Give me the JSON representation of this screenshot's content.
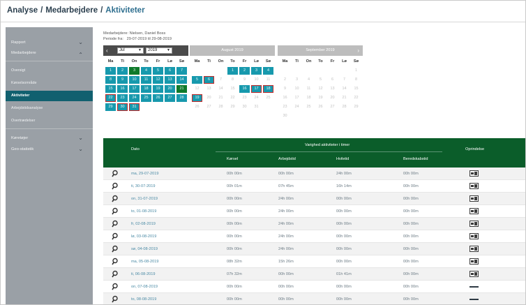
{
  "breadcrumb": {
    "part1": "Analyse",
    "part2": "Medarbejdere",
    "part3": "Aktiviteter",
    "separator": "/"
  },
  "sidebar": {
    "rapport": "Rapport",
    "medarbejdere": "Medarbejdere",
    "sub": [
      "Oversigt",
      "Kørselsområde",
      "Aktiviteter",
      "Arbejdstidsanalyse",
      "Overtrædelser"
    ],
    "active_index": 2,
    "koretojer": "Køretøjer",
    "geo": "Geo-statistik",
    "chevron_up": "⌃",
    "chevron_down": "⌄"
  },
  "info": {
    "employee_label": "Medarbejdere:",
    "employee_value": "Nielsen, Daniel Boss",
    "period_label": "Periode fra:",
    "period_value": "29-07-2019 til 29-08-2019"
  },
  "calendar": {
    "weekdays": [
      "Ma",
      "Ti",
      "On",
      "To",
      "Fr",
      "Lø",
      "Sø"
    ],
    "month_select": "Jul",
    "year_select": "2019",
    "prev": "‹",
    "next": "›",
    "months": [
      {
        "title": "",
        "header_style": "dark",
        "weeks": [
          [
            {
              "d": "1",
              "c": "teal"
            },
            {
              "d": "2",
              "c": "teal"
            },
            {
              "d": "3",
              "c": "green"
            },
            {
              "d": "4",
              "c": "teal"
            },
            {
              "d": "5",
              "c": "teal"
            },
            {
              "d": "6",
              "c": "teal"
            },
            {
              "d": "7",
              "c": "teal"
            }
          ],
          [
            {
              "d": "8",
              "c": "teal"
            },
            {
              "d": "9",
              "c": "teal"
            },
            {
              "d": "10",
              "c": "teal"
            },
            {
              "d": "11",
              "c": "teal"
            },
            {
              "d": "12",
              "c": "teal"
            },
            {
              "d": "13",
              "c": "teal"
            },
            {
              "d": "14",
              "c": "teal"
            }
          ],
          [
            {
              "d": "15",
              "c": "teal"
            },
            {
              "d": "16",
              "c": "teal"
            },
            {
              "d": "17",
              "c": "teal"
            },
            {
              "d": "18",
              "c": "teal"
            },
            {
              "d": "19",
              "c": "teal"
            },
            {
              "d": "20",
              "c": "teal"
            },
            {
              "d": "21",
              "c": "green"
            }
          ],
          [
            {
              "d": "22",
              "c": "teal red"
            },
            {
              "d": "23",
              "c": "teal"
            },
            {
              "d": "24",
              "c": "teal"
            },
            {
              "d": "25",
              "c": "teal"
            },
            {
              "d": "26",
              "c": "teal"
            },
            {
              "d": "27",
              "c": "teal"
            },
            {
              "d": "28",
              "c": "teal"
            }
          ],
          [
            {
              "d": "29",
              "c": "teal"
            },
            {
              "d": "30",
              "c": "teal red"
            },
            {
              "d": "31",
              "c": "teal red"
            },
            {
              "d": "",
              "c": ""
            },
            {
              "d": "",
              "c": ""
            },
            {
              "d": "",
              "c": ""
            },
            {
              "d": "",
              "c": ""
            }
          ]
        ]
      },
      {
        "title": "August 2019",
        "header_style": "light",
        "weeks": [
          [
            {
              "d": "",
              "c": ""
            },
            {
              "d": "",
              "c": ""
            },
            {
              "d": "",
              "c": ""
            },
            {
              "d": "1",
              "c": "teal"
            },
            {
              "d": "2",
              "c": "teal"
            },
            {
              "d": "3",
              "c": "teal"
            },
            {
              "d": "4",
              "c": "teal"
            }
          ],
          [
            {
              "d": "5",
              "c": "teal"
            },
            {
              "d": "6",
              "c": "teal red"
            },
            {
              "d": "7",
              "c": "mute"
            },
            {
              "d": "8",
              "c": "mute"
            },
            {
              "d": "9",
              "c": "mute"
            },
            {
              "d": "10",
              "c": "mute"
            },
            {
              "d": "11",
              "c": "mute"
            }
          ],
          [
            {
              "d": "12",
              "c": "mute"
            },
            {
              "d": "13",
              "c": "mute"
            },
            {
              "d": "14",
              "c": "mute"
            },
            {
              "d": "15",
              "c": "mute"
            },
            {
              "d": "16",
              "c": "teal"
            },
            {
              "d": "17",
              "c": "teal red"
            },
            {
              "d": "18",
              "c": "teal red"
            }
          ],
          [
            {
              "d": "19",
              "c": "teal red"
            },
            {
              "d": "20",
              "c": "mute"
            },
            {
              "d": "21",
              "c": "mute"
            },
            {
              "d": "22",
              "c": "mute"
            },
            {
              "d": "23",
              "c": "mute"
            },
            {
              "d": "24",
              "c": "mute"
            },
            {
              "d": "25",
              "c": "mute"
            }
          ],
          [
            {
              "d": "26",
              "c": "mute"
            },
            {
              "d": "27",
              "c": "mute"
            },
            {
              "d": "28",
              "c": "mute"
            },
            {
              "d": "29",
              "c": "mute"
            },
            {
              "d": "30",
              "c": "mute"
            },
            {
              "d": "31",
              "c": "mute"
            },
            {
              "d": "",
              "c": ""
            }
          ]
        ]
      },
      {
        "title": "September 2019",
        "header_style": "light",
        "weeks": [
          [
            {
              "d": "",
              "c": ""
            },
            {
              "d": "",
              "c": ""
            },
            {
              "d": "",
              "c": ""
            },
            {
              "d": "",
              "c": ""
            },
            {
              "d": "",
              "c": ""
            },
            {
              "d": "",
              "c": ""
            },
            {
              "d": "1",
              "c": "mute"
            }
          ],
          [
            {
              "d": "2",
              "c": "mute"
            },
            {
              "d": "3",
              "c": "mute"
            },
            {
              "d": "4",
              "c": "mute"
            },
            {
              "d": "5",
              "c": "mute"
            },
            {
              "d": "6",
              "c": "mute"
            },
            {
              "d": "7",
              "c": "mute"
            },
            {
              "d": "8",
              "c": "mute"
            }
          ],
          [
            {
              "d": "9",
              "c": "mute"
            },
            {
              "d": "10",
              "c": "mute"
            },
            {
              "d": "11",
              "c": "mute"
            },
            {
              "d": "12",
              "c": "mute"
            },
            {
              "d": "13",
              "c": "mute"
            },
            {
              "d": "14",
              "c": "mute"
            },
            {
              "d": "15",
              "c": "mute"
            }
          ],
          [
            {
              "d": "16",
              "c": "mute"
            },
            {
              "d": "17",
              "c": "mute"
            },
            {
              "d": "18",
              "c": "mute"
            },
            {
              "d": "19",
              "c": "mute"
            },
            {
              "d": "20",
              "c": "mute"
            },
            {
              "d": "21",
              "c": "mute"
            },
            {
              "d": "22",
              "c": "mute"
            }
          ],
          [
            {
              "d": "23",
              "c": "mute"
            },
            {
              "d": "24",
              "c": "mute"
            },
            {
              "d": "25",
              "c": "mute"
            },
            {
              "d": "26",
              "c": "mute"
            },
            {
              "d": "27",
              "c": "mute"
            },
            {
              "d": "28",
              "c": "mute"
            },
            {
              "d": "29",
              "c": "mute"
            }
          ],
          [
            {
              "d": "30",
              "c": "mute"
            },
            {
              "d": "",
              "c": ""
            },
            {
              "d": "",
              "c": ""
            },
            {
              "d": "",
              "c": ""
            },
            {
              "d": "",
              "c": ""
            },
            {
              "d": "",
              "c": ""
            },
            {
              "d": "",
              "c": ""
            }
          ]
        ]
      }
    ]
  },
  "table": {
    "col_dato": "Dato",
    "group_title": "Varighed aktiviteter i timer",
    "col_korsel": "Kørsel",
    "col_arbejd": "Arbejdstid",
    "col_hvile": "Hviletid",
    "col_beredskab": "Beredskabstid",
    "col_oprindelse": "Oprindelse",
    "rows": [
      {
        "date": "ma, 29-07-2019",
        "korsel": "00h 00m",
        "arbejd": "00h 00m",
        "hvile": "24h 00m",
        "beredskab": "00h 00m",
        "orig": "icon"
      },
      {
        "date": "ti, 30-07-2019",
        "korsel": "00h 01m",
        "arbejd": "07h 45m",
        "hvile": "16h 14m",
        "beredskab": "00h 00m",
        "orig": "icon"
      },
      {
        "date": "on, 31-07-2019",
        "korsel": "00h 00m",
        "arbejd": "24h 00m",
        "hvile": "00h 00m",
        "beredskab": "00h 00m",
        "orig": "icon"
      },
      {
        "date": "to, 01-08-2019",
        "korsel": "00h 00m",
        "arbejd": "24h 00m",
        "hvile": "00h 00m",
        "beredskab": "00h 00m",
        "orig": "icon"
      },
      {
        "date": "fr, 02-08-2019",
        "korsel": "00h 00m",
        "arbejd": "24h 00m",
        "hvile": "00h 00m",
        "beredskab": "00h 00m",
        "orig": "icon"
      },
      {
        "date": "lø, 03-08-2019",
        "korsel": "00h 00m",
        "arbejd": "24h 00m",
        "hvile": "00h 00m",
        "beredskab": "00h 00m",
        "orig": "icon"
      },
      {
        "date": "sø, 04-08-2019",
        "korsel": "00h 00m",
        "arbejd": "24h 00m",
        "hvile": "00h 00m",
        "beredskab": "00h 00m",
        "orig": "icon"
      },
      {
        "date": "ma, 05-08-2019",
        "korsel": "08h 32m",
        "arbejd": "15h 26m",
        "hvile": "00h 00m",
        "beredskab": "00h 00m",
        "orig": "icon"
      },
      {
        "date": "ti, 06-08-2019",
        "korsel": "07h 32m",
        "arbejd": "00h 00m",
        "hvile": "01h 41m",
        "beredskab": "00h 00m",
        "orig": "icon"
      },
      {
        "date": "on, 07-08-2019",
        "korsel": "00h 00m",
        "arbejd": "00h 00m",
        "hvile": "00h 00m",
        "beredskab": "00h 00m",
        "orig": "dash"
      },
      {
        "date": "to, 08-08-2019",
        "korsel": "00h 00m",
        "arbejd": "00h 00m",
        "hvile": "00h 00m",
        "beredskab": "00h 00m",
        "orig": "dash"
      }
    ]
  },
  "colors": {
    "teal": "#1799ad",
    "green": "#0f7a2a",
    "header_green": "#0b5d2a",
    "sidebar": "#9aa0a6",
    "active": "#11606f",
    "red_border": "#c62828"
  }
}
